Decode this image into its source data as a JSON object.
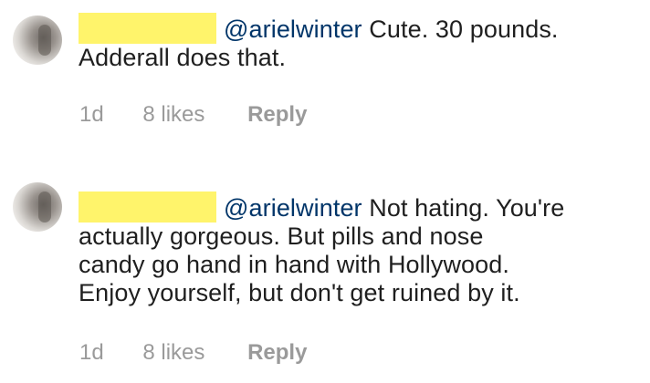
{
  "comments": [
    {
      "mention": "@arielwinter",
      "line1": "Cute. 30 pounds.",
      "lines": [
        "Adderall does that."
      ],
      "time": "1d",
      "likes": "8 likes",
      "reply": "Reply"
    },
    {
      "mention": "@arielwinter",
      "line1": "Not hating.  You're",
      "lines": [
        "actually gorgeous. But pills and nose",
        "candy go hand in hand with Hollywood.",
        "Enjoy yourself,  but don't get ruined by it."
      ],
      "time": "1d",
      "likes": "8 likes",
      "reply": "Reply"
    }
  ]
}
